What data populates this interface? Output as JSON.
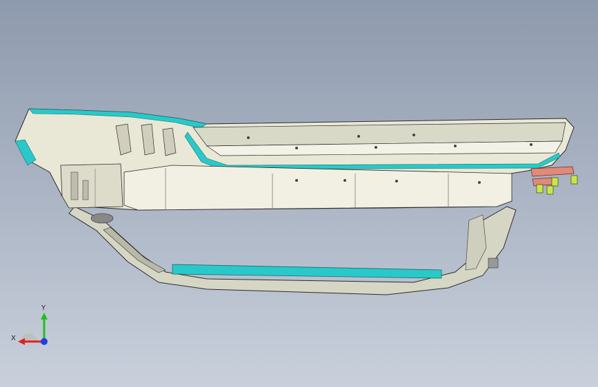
{
  "viewport": {
    "background_top": "#8e9aad",
    "background_bottom": "#c9d0dc"
  },
  "model": {
    "part_color": "#e9e8d6",
    "edge_color": "#2a2a2a",
    "highlight_color": "#29c9c9",
    "fastener_color": "#e08a7a",
    "bolt_color": "#c8e64a"
  },
  "triad": {
    "x_label": "X",
    "y_label": "Y",
    "x_color": "#e0201e",
    "y_color": "#20c020",
    "z_color": "#2040e0",
    "icons": [
      "triad-x-axis-icon",
      "triad-y-axis-icon",
      "triad-z-axis-icon"
    ]
  }
}
